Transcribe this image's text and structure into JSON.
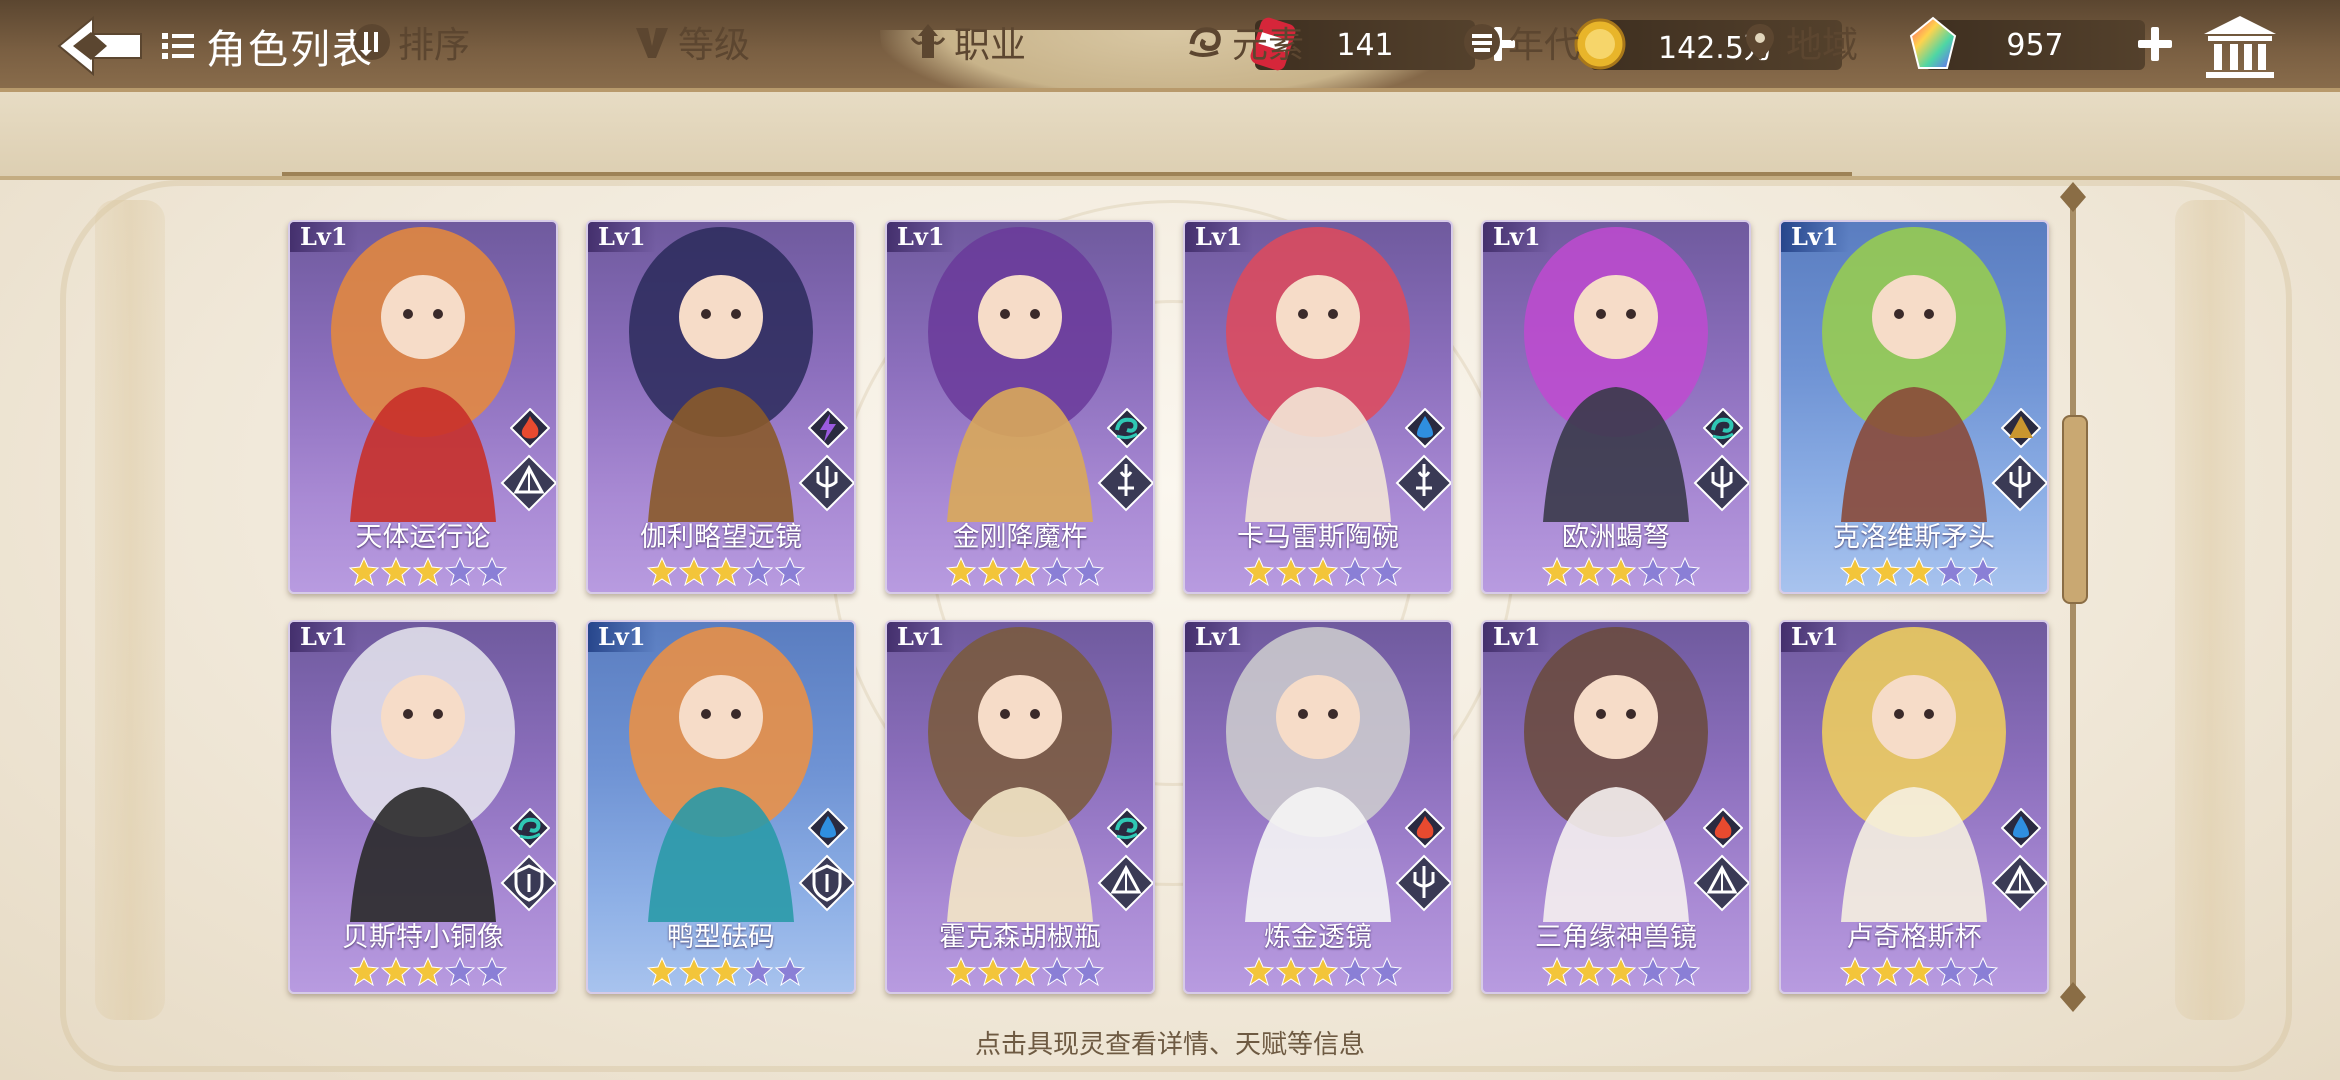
{
  "header": {
    "title": "角色列表",
    "resources": [
      {
        "name": "stamina",
        "value": "141",
        "icon": "red-can-icon"
      },
      {
        "name": "gold",
        "value": "142.5万",
        "icon": "gold-coin-icon"
      },
      {
        "name": "crystal",
        "value": "957",
        "icon": "rainbow-gem-icon"
      }
    ]
  },
  "tabs": [
    {
      "label": "排序",
      "icon": "sort-icon"
    },
    {
      "label": "等级",
      "icon": "level-v-icon"
    },
    {
      "label": "职业",
      "icon": "class-icon"
    },
    {
      "label": "元素",
      "icon": "element-swirl-icon"
    },
    {
      "label": "年代",
      "icon": "era-icon"
    },
    {
      "label": "地域",
      "icon": "location-pin-icon"
    }
  ],
  "cards": [
    {
      "level": "Lv1",
      "name": "天体运行论",
      "stars": 3,
      "max_stars": 5,
      "element": "fire",
      "class": "pyramid",
      "frame": "purple"
    },
    {
      "level": "Lv1",
      "name": "伽利略望远镜",
      "stars": 3,
      "max_stars": 5,
      "element": "lightning",
      "class": "trident",
      "frame": "purple"
    },
    {
      "level": "Lv1",
      "name": "金刚降魔杵",
      "stars": 3,
      "max_stars": 5,
      "element": "wind",
      "class": "sword",
      "frame": "purple"
    },
    {
      "level": "Lv1",
      "name": "卡马雷斯陶碗",
      "stars": 3,
      "max_stars": 5,
      "element": "water",
      "class": "sword",
      "frame": "purple"
    },
    {
      "level": "Lv1",
      "name": "欧洲蝎弩",
      "stars": 3,
      "max_stars": 5,
      "element": "wind",
      "class": "trident",
      "frame": "purple"
    },
    {
      "level": "Lv1",
      "name": "克洛维斯矛头",
      "stars": 3,
      "max_stars": 5,
      "element": "earth",
      "class": "trident",
      "frame": "blue"
    },
    {
      "level": "Lv1",
      "name": "贝斯特小铜像",
      "stars": 3,
      "max_stars": 5,
      "element": "wind",
      "class": "shield",
      "frame": "purple"
    },
    {
      "level": "Lv1",
      "name": "鸭型砝码",
      "stars": 3,
      "max_stars": 5,
      "element": "water",
      "class": "shield",
      "frame": "blue"
    },
    {
      "level": "Lv1",
      "name": "霍克森胡椒瓶",
      "stars": 3,
      "max_stars": 5,
      "element": "wind",
      "class": "pyramid",
      "frame": "purple"
    },
    {
      "level": "Lv1",
      "name": "炼金透镜",
      "stars": 3,
      "max_stars": 5,
      "element": "fire",
      "class": "trident",
      "frame": "purple"
    },
    {
      "level": "Lv1",
      "name": "三角缘神兽镜",
      "stars": 3,
      "max_stars": 5,
      "element": "fire",
      "class": "pyramid",
      "frame": "purple"
    },
    {
      "level": "Lv1",
      "name": "卢奇格斯杯",
      "stars": 3,
      "max_stars": 5,
      "element": "water",
      "class": "pyramid",
      "frame": "purple"
    }
  ],
  "footer": {
    "hint": "点击具现灵查看详情、天赋等信息"
  },
  "colors": {
    "topbar": "#6b543a",
    "tabbar": "#e2d6bc",
    "card_purple": "#8c6fbd",
    "card_blue": "#6f93d4",
    "star_filled": "#f3c53a",
    "star_empty": "#8a7fd6",
    "fire": "#e84a2f",
    "water": "#2f8fe0",
    "wind": "#2fc7b4",
    "lightning": "#9b5be0",
    "earth": "#c9962f"
  }
}
